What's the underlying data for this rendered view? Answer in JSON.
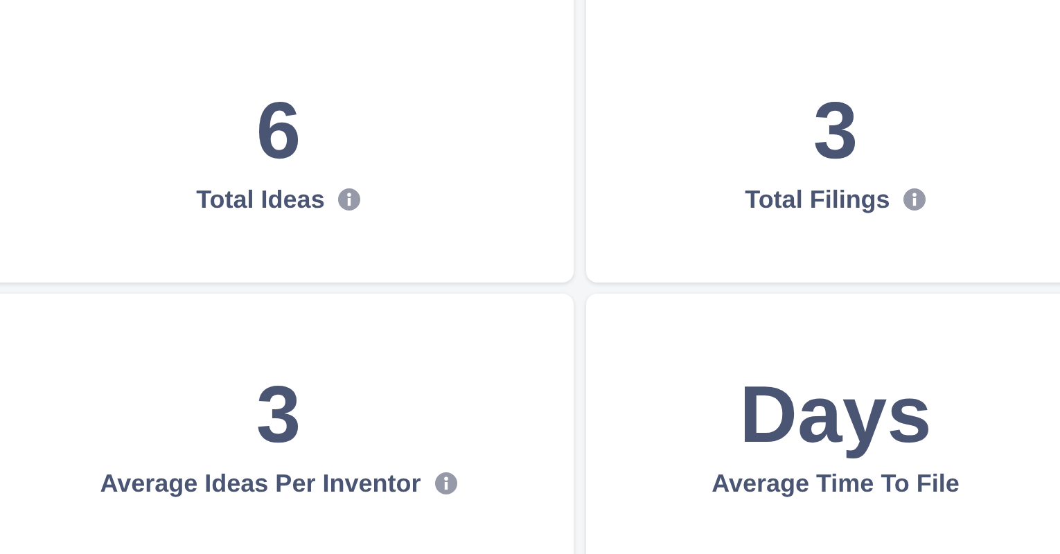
{
  "cards": [
    {
      "value": "6",
      "label": "Total Ideas",
      "info": true
    },
    {
      "value": "3",
      "label": "Total Filings",
      "info": true
    },
    {
      "value": "3",
      "label": "Average Ideas Per Inventor",
      "info": true
    },
    {
      "value": "Days",
      "label": "Average Time To File",
      "info": false
    }
  ]
}
